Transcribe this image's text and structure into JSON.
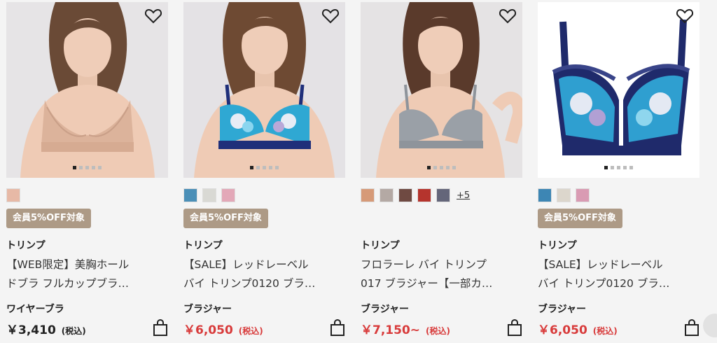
{
  "products": [
    {
      "brand": "トリンプ",
      "name_line1": "【WEB限定】美胸ホール",
      "name_line2": "ドブラ フルカップブラ…",
      "category": "ワイヤーブラ",
      "price": "￥3,410",
      "tax": "(税込)",
      "sale": false,
      "badge": "会員5%OFF対象",
      "swatches": [
        "#e7b9a6"
      ],
      "more": "",
      "image_dots": 5,
      "active_dot": 0,
      "icons": {
        "favorite": "heart-outline-icon",
        "cart": "shopping-bag-icon"
      }
    },
    {
      "brand": "トリンプ",
      "name_line1": "【SALE】レッドレーベル",
      "name_line2": "バイ トリンプ0120 ブラ…",
      "category": "ブラジャー",
      "price": "￥6,050",
      "tax": "(税込)",
      "sale": true,
      "badge": "会員5%OFF対象",
      "swatches": [
        "#4b8fb7",
        "#d9d9d4",
        "#e3a8b8"
      ],
      "more": "",
      "image_dots": 5,
      "active_dot": 0,
      "icons": {
        "favorite": "heart-outline-icon",
        "cart": "shopping-bag-icon"
      }
    },
    {
      "brand": "トリンプ",
      "name_line1": "フロラーレ バイ トリンプ",
      "name_line2": "017 ブラジャー【一部カ…",
      "category": "ブラジャー",
      "price": "￥7,150~",
      "tax": "(税込)",
      "sale": true,
      "badge": "",
      "swatches": [
        "#d69a78",
        "#b4a9a4",
        "#6f4a42",
        "#b5342d",
        "#64667a"
      ],
      "more": "+5",
      "image_dots": 5,
      "active_dot": 0,
      "icons": {
        "favorite": "heart-outline-icon",
        "cart": "shopping-bag-icon"
      }
    },
    {
      "brand": "トリンプ",
      "name_line1": "【SALE】レッドレーベル",
      "name_line2": "バイ トリンプ0120 ブラ…",
      "category": "ブラジャー",
      "price": "￥6,050",
      "tax": "(税込)",
      "sale": true,
      "badge": "会員5%OFF対象",
      "swatches": [
        "#3d86b4",
        "#dcd6cc",
        "#d99bb3"
      ],
      "more": "",
      "image_dots": 5,
      "active_dot": 0,
      "icons": {
        "favorite": "heart-outline-icon",
        "cart": "shopping-bag-icon"
      }
    }
  ],
  "colors": {
    "sale_price": "#d83b3b",
    "badge_bg": "#ad9a86",
    "page_bg": "#f4f4f4"
  }
}
